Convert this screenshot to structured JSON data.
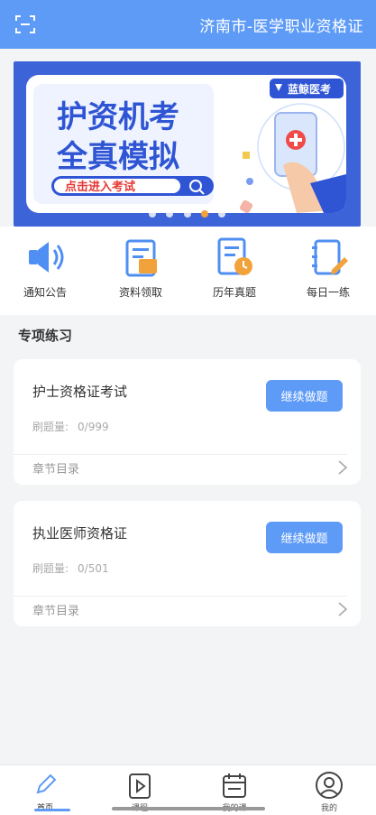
{
  "header": {
    "title": "济南市-医学职业资格证",
    "scan_icon": "scan-icon"
  },
  "banner": {
    "line1": "护资机考",
    "line2": "全真模拟",
    "cta": "点击进入考试",
    "brand": "蓝鲸医考",
    "slides": 5,
    "active_slide": 3
  },
  "quick_menu": [
    {
      "label": "通知公告",
      "icon": "speaker-icon"
    },
    {
      "label": "资料领取",
      "icon": "document-icon"
    },
    {
      "label": "历年真题",
      "icon": "exam-paper-icon"
    },
    {
      "label": "每日一练",
      "icon": "daily-practice-icon"
    }
  ],
  "section_title": "专项练习",
  "cards": [
    {
      "title": "护士资格证考试",
      "count_label": "刷题量:",
      "count_value": "0/999",
      "button": "继续做题",
      "chapter": "章节目录"
    },
    {
      "title": "执业医师资格证",
      "count_label": "刷题量:",
      "count_value": "0/501",
      "button": "继续做题",
      "chapter": "章节目录"
    }
  ],
  "tabbar": [
    {
      "label": "首页",
      "icon": "pencil-icon",
      "active": true
    },
    {
      "label": "课程",
      "icon": "video-icon",
      "active": false
    },
    {
      "label": "我的课",
      "icon": "calendar-icon",
      "active": false
    },
    {
      "label": "我的",
      "icon": "user-icon",
      "active": false
    }
  ],
  "colors": {
    "primary": "#5e9bf7",
    "banner_blue": "#3d63d8",
    "accent_orange": "#f2a23a"
  }
}
